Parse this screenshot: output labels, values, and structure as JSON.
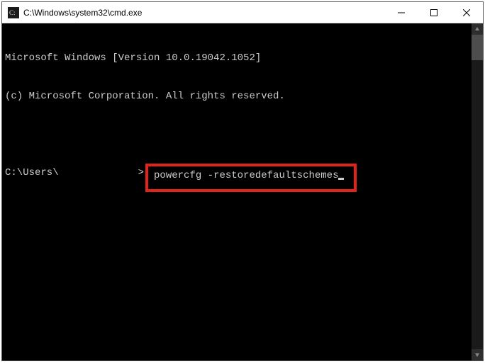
{
  "titlebar": {
    "title": "C:\\Windows\\system32\\cmd.exe"
  },
  "console": {
    "line1": "Microsoft Windows [Version 10.0.19042.1052]",
    "line2": "(c) Microsoft Corporation. All rights reserved.",
    "prompt_prefix": "C:\\Users\\",
    "prompt_suffix": ">",
    "command": "powercfg -restoredefaultschemes"
  }
}
